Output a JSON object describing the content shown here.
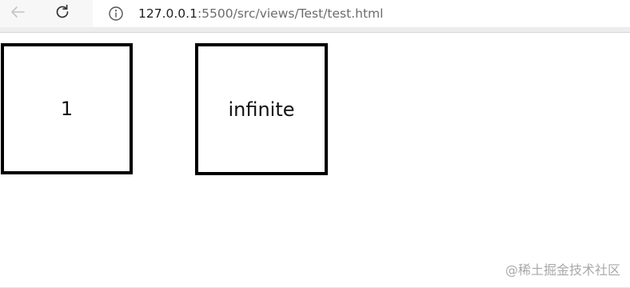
{
  "browser": {
    "url_host": "127.0.0.1",
    "url_path": ":5500/src/views/Test/test.html",
    "icons": {
      "back": "back-arrow-icon",
      "reload": "reload-icon",
      "info": "info-icon"
    }
  },
  "page": {
    "boxes": [
      {
        "text": "1"
      },
      {
        "text": "infinite"
      }
    ]
  },
  "watermark": "@稀土掘金技术社区",
  "colors": {
    "box_border": "#000000",
    "toolbar_bg": "#f7f7f7",
    "url_path": "#6b6b6b"
  }
}
